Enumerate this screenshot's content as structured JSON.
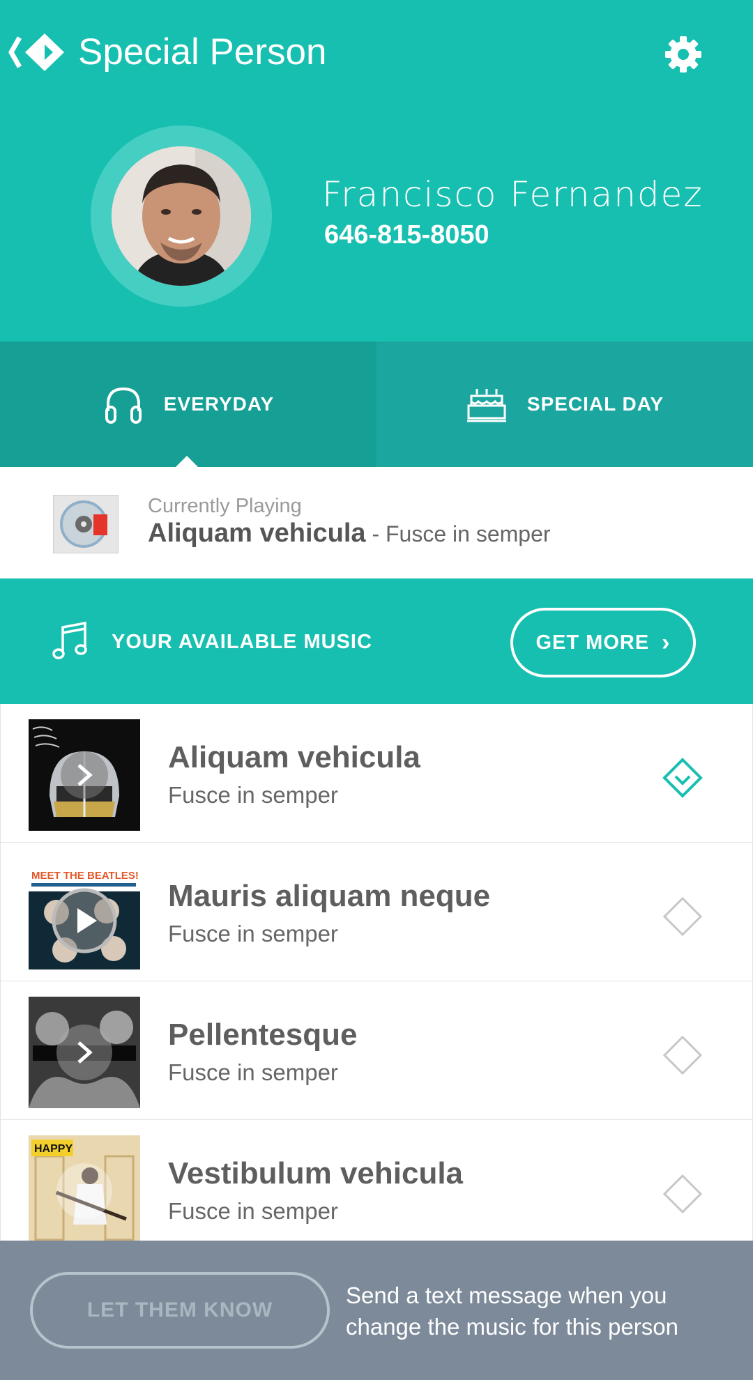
{
  "app": {
    "title": "Special Person"
  },
  "contact": {
    "name": "Francisco Fernandez",
    "phone": "646-815-8050"
  },
  "tabs": [
    {
      "label": "EVERYDAY",
      "icon": "headphones-icon",
      "selected": true
    },
    {
      "label": "SPECIAL DAY",
      "icon": "birthday-cake-icon",
      "selected": false
    }
  ],
  "now_playing": {
    "caption": "Currently Playing",
    "song": "Aliquam vehicula",
    "separator": " - ",
    "artist": "Fusce in semper"
  },
  "available_music": {
    "label": "YOUR AVAILABLE MUSIC",
    "get_more_label": "GET MORE",
    "get_more_chevron": "›"
  },
  "songs": [
    {
      "title": "Aliquam vehicula",
      "artist": "Fusce in semper",
      "selected": true
    },
    {
      "title": "Mauris aliquam neque",
      "artist": "Fusce in semper",
      "selected": false
    },
    {
      "title": "Pellentesque",
      "artist": "Fusce in semper",
      "selected": false
    },
    {
      "title": "Vestibulum vehicula",
      "artist": "Fusce in semper",
      "selected": false
    }
  ],
  "bottom": {
    "button_label": "LET THEM KNOW",
    "message": "Send a text message when you change the music for this person"
  },
  "album_art_text": {
    "beatles": "MEET THE BEATLES!",
    "happy": "HAPPY"
  },
  "colors": {
    "accent": "#17bfb0",
    "tab_selected": "#169f95",
    "tab_unselected": "#1ba7a0",
    "footer": "#7d8a99"
  }
}
